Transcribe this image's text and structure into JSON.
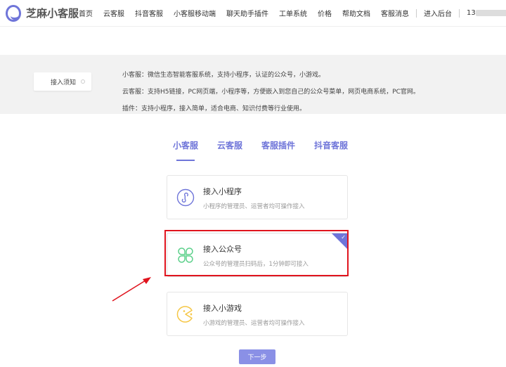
{
  "header": {
    "logo_text": "芝麻小客服",
    "nav": [
      "首页",
      "云客服",
      "抖音客服",
      "小客服移动端",
      "聊天助手插件",
      "工单系统",
      "价格",
      "帮助文档",
      "客服消息",
      "进入后台"
    ],
    "account_prefix": "13"
  },
  "info": {
    "tab_label": "接入须知",
    "lines": [
      "小客服：微信生态智能客服系统，支持小程序，认证的公众号，小游戏。",
      "云客服：支持H5链接，PC网页端，小程序等，方便嵌入到您自己的公众号菜单，网页电商系统，PC官网。",
      "插件：支持小程序，接入简单，适合电商、知识付费等行业使用。"
    ]
  },
  "tabs": [
    "小客服",
    "云客服",
    "客服插件",
    "抖音客服"
  ],
  "cards": [
    {
      "title": "接入小程序",
      "desc": "小程序的管理员、运营者均可操作接入",
      "icon": "mini-program-icon"
    },
    {
      "title": "接入公众号",
      "desc": "公众号的管理员扫码后，1分钟即可接入",
      "icon": "clover-icon"
    },
    {
      "title": "接入小游戏",
      "desc": "小游戏的管理员、运营者均可操作接入",
      "icon": "pacman-icon"
    }
  ],
  "next_button": "下一步",
  "colors": {
    "accent": "#6f75d9",
    "highlight": "#e0141e",
    "green": "#5bd08a",
    "yellow": "#f5c644"
  }
}
